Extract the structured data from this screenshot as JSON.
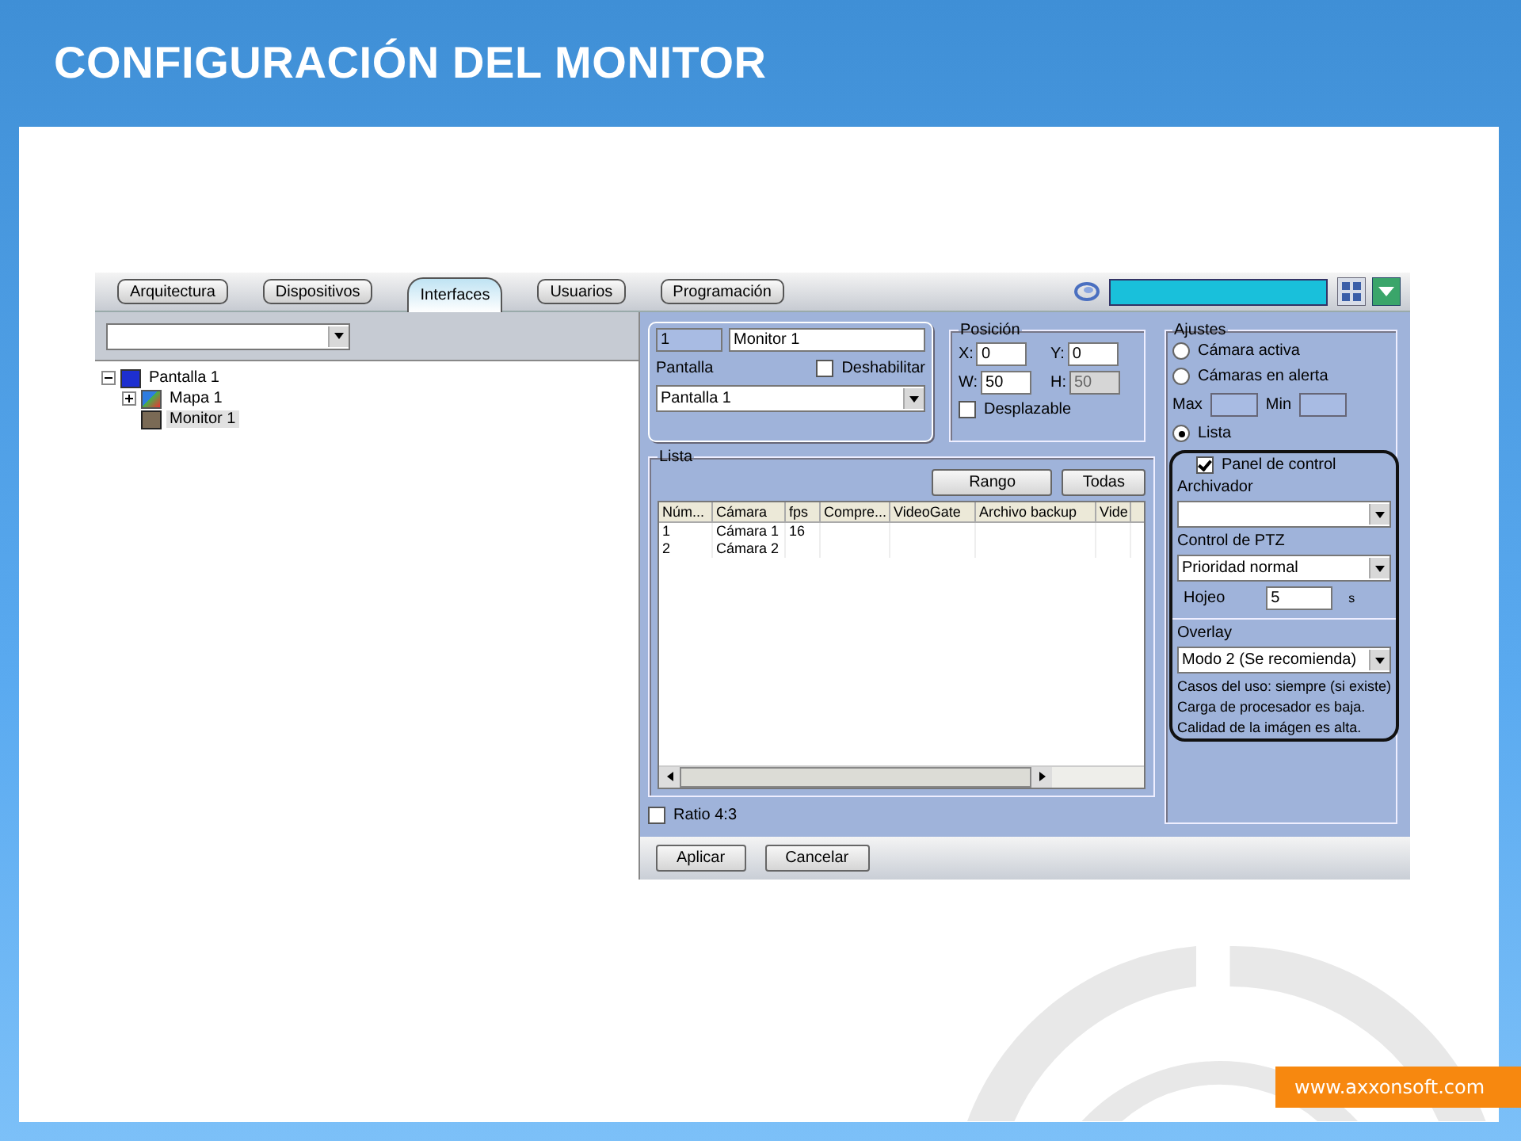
{
  "slide": {
    "title": "CONFIGURACIÓN DEL MONITOR",
    "footer_link": "www.axxonsoft.com"
  },
  "tabs": [
    {
      "label": "Arquitectura",
      "selected": false
    },
    {
      "label": "Dispositivos",
      "selected": false
    },
    {
      "label": "Interfaces",
      "selected": true
    },
    {
      "label": "Usuarios",
      "selected": false
    },
    {
      "label": "Programación",
      "selected": false
    }
  ],
  "tree": [
    {
      "label": "Pantalla 1",
      "kind": "screen",
      "expanded": true,
      "selected": false,
      "children": [
        {
          "label": "Mapa 1",
          "kind": "map",
          "expanded": false,
          "selected": false
        },
        {
          "label": "Monitor 1",
          "kind": "monitor",
          "selected": true
        }
      ]
    }
  ],
  "monitor": {
    "id": "1",
    "name": "Monitor 1",
    "screen_label": "Pantalla",
    "screen_value": "Pantalla 1",
    "disable": {
      "label": "Deshabilitar",
      "checked": false
    }
  },
  "position": {
    "title": "Posición",
    "fields": [
      {
        "label": "X:",
        "value": "0",
        "disabled": false
      },
      {
        "label": "Y:",
        "value": "0",
        "disabled": false
      },
      {
        "label": "W:",
        "value": "50",
        "disabled": false
      },
      {
        "label": "H:",
        "value": "50",
        "disabled": true
      }
    ],
    "scrollable": {
      "label": "Desplazable",
      "checked": false
    }
  },
  "list": {
    "title": "Lista",
    "buttons": [
      "Rango",
      "Todas"
    ],
    "columns": [
      "Núm...",
      "Cámara",
      "fps",
      "Compre...",
      "VideoGate",
      "Archivo backup",
      "Vide"
    ],
    "rows": [
      [
        "1",
        "Cámara 1",
        "16"
      ],
      [
        "2",
        "Cámara 2"
      ]
    ]
  },
  "ratio": {
    "label": "Ratio 4:3",
    "checked": false
  },
  "settings": {
    "title": "Ajustes",
    "modes": [
      {
        "label": "Cámara activa",
        "selected": false
      },
      {
        "label": "Cámaras en alerta",
        "selected": false
      },
      {
        "label": "Lista",
        "selected": true
      }
    ],
    "max_label": "Max",
    "min_label": "Min",
    "control_panel": {
      "label": "Panel de control",
      "checked": true
    },
    "archiver_label": "Archivador",
    "ptz_label": "Control de PTZ",
    "ptz_value": "Prioridad normal",
    "browse_label": "Hojeo",
    "browse_value": "5",
    "browse_unit": "s",
    "overlay": {
      "title": "Overlay",
      "value": "Modo 2 (Se recomienda)",
      "notes": [
        "Casos del uso: siempre (si existe)",
        "Carga de procesador es baja.",
        "Calidad de la imágen es alta."
      ]
    }
  },
  "actions": [
    "Aplicar",
    "Cancelar"
  ]
}
